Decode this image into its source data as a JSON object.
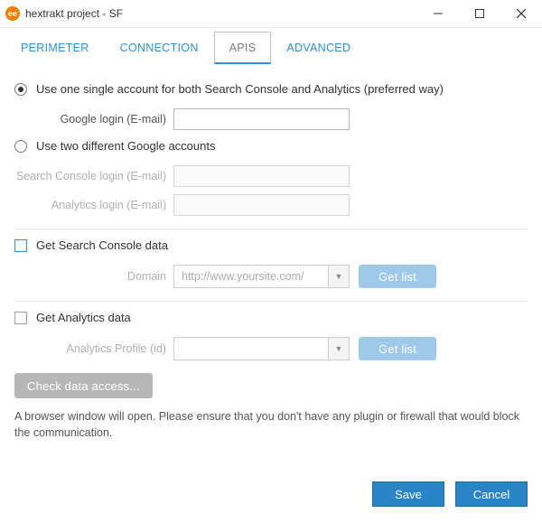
{
  "window": {
    "app_icon_text": "ee",
    "title": "hextrakt project - SF"
  },
  "tabs": [
    {
      "label": "PERIMETER",
      "active": false
    },
    {
      "label": "CONNECTION",
      "active": false
    },
    {
      "label": "APIS",
      "active": true
    },
    {
      "label": "ADVANCED",
      "active": false
    }
  ],
  "option_single": {
    "label": "Use one single account for both Search Console and Analytics (preferred way)",
    "selected": true,
    "google_login_label": "Google login (E-mail)",
    "google_login_value": ""
  },
  "option_two": {
    "label": "Use two different Google accounts",
    "selected": false,
    "sc_login_label": "Search Console login (E-mail)",
    "sc_login_value": "",
    "an_login_label": "Analytics login (E-mail)",
    "an_login_value": ""
  },
  "sc_section": {
    "checkbox_label": "Get Search Console data",
    "checked": false,
    "domain_label": "Domain",
    "domain_value": "http://www.yoursite.com/",
    "get_list_label": "Get list"
  },
  "an_section": {
    "checkbox_label": "Get Analytics data",
    "checked": false,
    "profile_label": "Analytics Profile (id)",
    "profile_value": "",
    "get_list_label": "Get list"
  },
  "check_access_label": "Check data access...",
  "note_text": "A browser window will open. Please ensure that you don't have any plugin or firewall that would block the communication.",
  "footer": {
    "save_label": "Save",
    "cancel_label": "Cancel"
  }
}
